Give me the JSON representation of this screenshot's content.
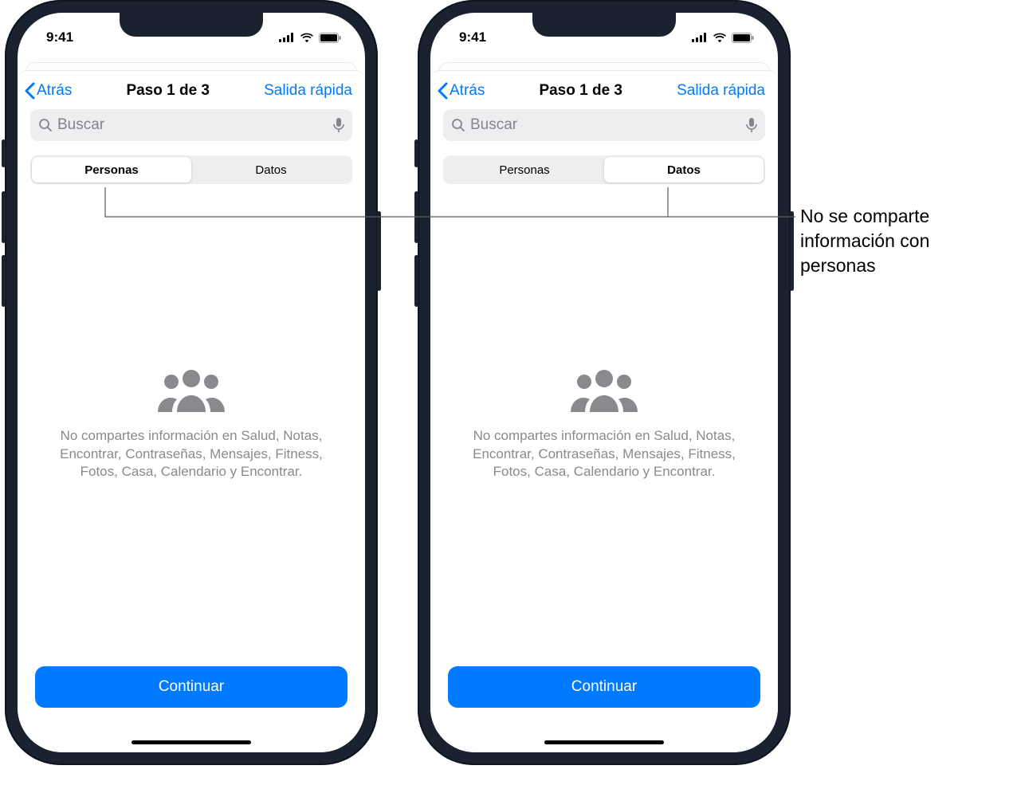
{
  "status": {
    "time": "9:41"
  },
  "nav": {
    "back": "Atrás",
    "title": "Paso 1 de 3",
    "quick_exit": "Salida rápida"
  },
  "search": {
    "placeholder": "Buscar"
  },
  "segments": {
    "people": "Personas",
    "data": "Datos"
  },
  "empty": {
    "message": "No compartes información en Salud, Notas, Encontrar, Contraseñas, Mensajes, Fitness, Fotos, Casa, Calendario y Encontrar."
  },
  "primary": {
    "continue": "Continuar"
  },
  "callout": {
    "line1": "No se comparte",
    "line2": "información con",
    "line3": "personas"
  }
}
